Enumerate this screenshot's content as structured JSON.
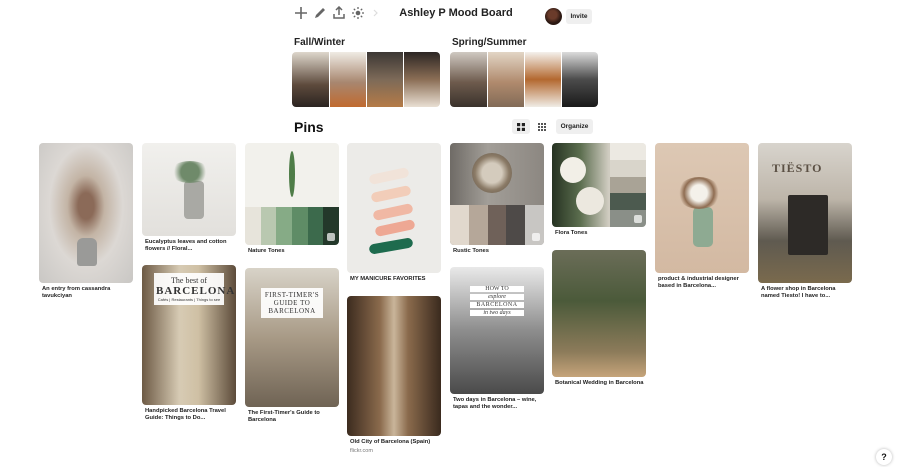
{
  "board": {
    "title": "Ashley P Mood Board",
    "invite_label": "Invite"
  },
  "sections": [
    {
      "title": "Fall/Winter"
    },
    {
      "title": "Spring/Summer"
    }
  ],
  "pins_header": {
    "title": "Pins",
    "organize_label": "Organize"
  },
  "pins": [
    {
      "caption": "An entry from cassandra tavukciyan"
    },
    {
      "caption": "Eucalyptus leaves and cotton flowers // Floral..."
    },
    {
      "caption": "Nature Tones"
    },
    {
      "caption": "MY MANICURE FAVORITES"
    },
    {
      "caption": "Rustic Tones"
    },
    {
      "caption": "Flora Tones"
    },
    {
      "caption": "product & industrial designer based in Barcelona..."
    },
    {
      "caption": "A flower shop in Barcelona named Tiesto! I have to..."
    },
    {
      "caption": "Handpicked Barcelona Travel Guide: Things to Do...",
      "overlay": [
        "The best of",
        "BARCELONA",
        "Cafés | Restaurants | Things to see"
      ]
    },
    {
      "caption": "The First-Timer's Guide to Barcelona",
      "overlay": [
        "FIRST-TIMER'S",
        "GUIDE TO",
        "BARCELONA"
      ]
    },
    {
      "caption": "Old City of Barcelona (Spain)",
      "source": "flickr.com"
    },
    {
      "caption": "Two days in Barcelona – wine, tapas and the wonder...",
      "overlay": [
        "HOW TO",
        "explore",
        "BARCELONA",
        "in two days"
      ]
    },
    {
      "caption": "Botanical Wedding in Barcelona"
    }
  ],
  "shop_sign": "TIËSTO",
  "help_label": "?",
  "colors": {
    "nature_swatches": [
      "#e7e4db",
      "#b9c8b0",
      "#86ab86",
      "#5f8c66",
      "#3c6a4c",
      "#23382a"
    ],
    "rustic_swatches": [
      "#e1d8cd",
      "#b5a799",
      "#6f6159",
      "#4e4a48",
      "#c8c6c3"
    ],
    "flora_swatches": [
      "#ece9e2",
      "#d9d5cb",
      "#a9a396",
      "#4c5a4f",
      "#8a8f88"
    ],
    "manicure_strokes": [
      "#f1e3d9",
      "#f2cdb9",
      "#f0b8a4",
      "#eea894",
      "#1e6b4e"
    ]
  }
}
